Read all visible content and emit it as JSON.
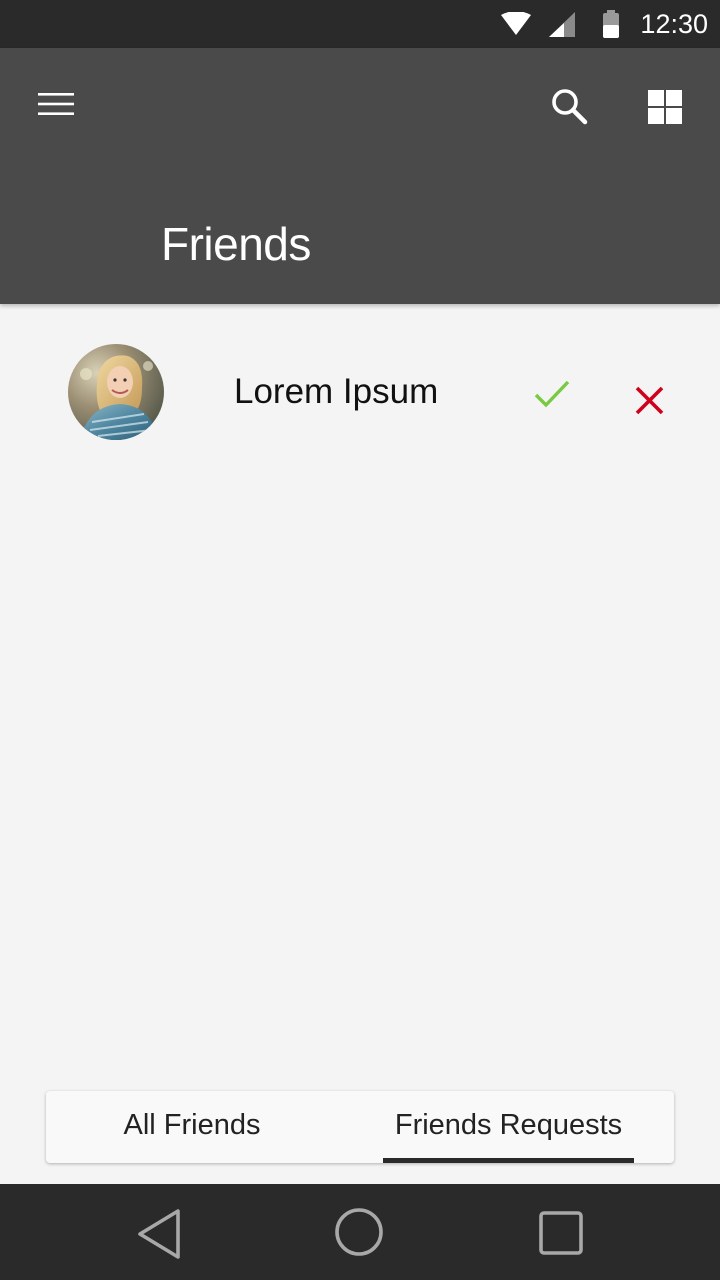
{
  "status_bar": {
    "time": "12:30",
    "icons": [
      "wifi-icon",
      "signal-icon",
      "battery-icon"
    ]
  },
  "app_bar": {
    "title": "Friends",
    "icons": [
      "menu-icon",
      "search-icon",
      "grid-view-icon"
    ]
  },
  "requests": [
    {
      "name": "Lorem Ipsum",
      "accept_icon": "check-icon",
      "reject_icon": "close-icon"
    }
  ],
  "tabs": [
    {
      "label": "All Friends",
      "selected": false
    },
    {
      "label": "Friends Requests",
      "selected": true
    }
  ],
  "nav_bar": {
    "icons": [
      "back-icon",
      "home-icon",
      "recent-apps-icon"
    ]
  },
  "colors": {
    "status_bar": "#2a2a2a",
    "app_bar": "#4a4a4a",
    "background": "#f4f4f4",
    "accept": "#7ac943",
    "reject": "#d0021b",
    "tab_indicator": "#2a2a2a"
  }
}
